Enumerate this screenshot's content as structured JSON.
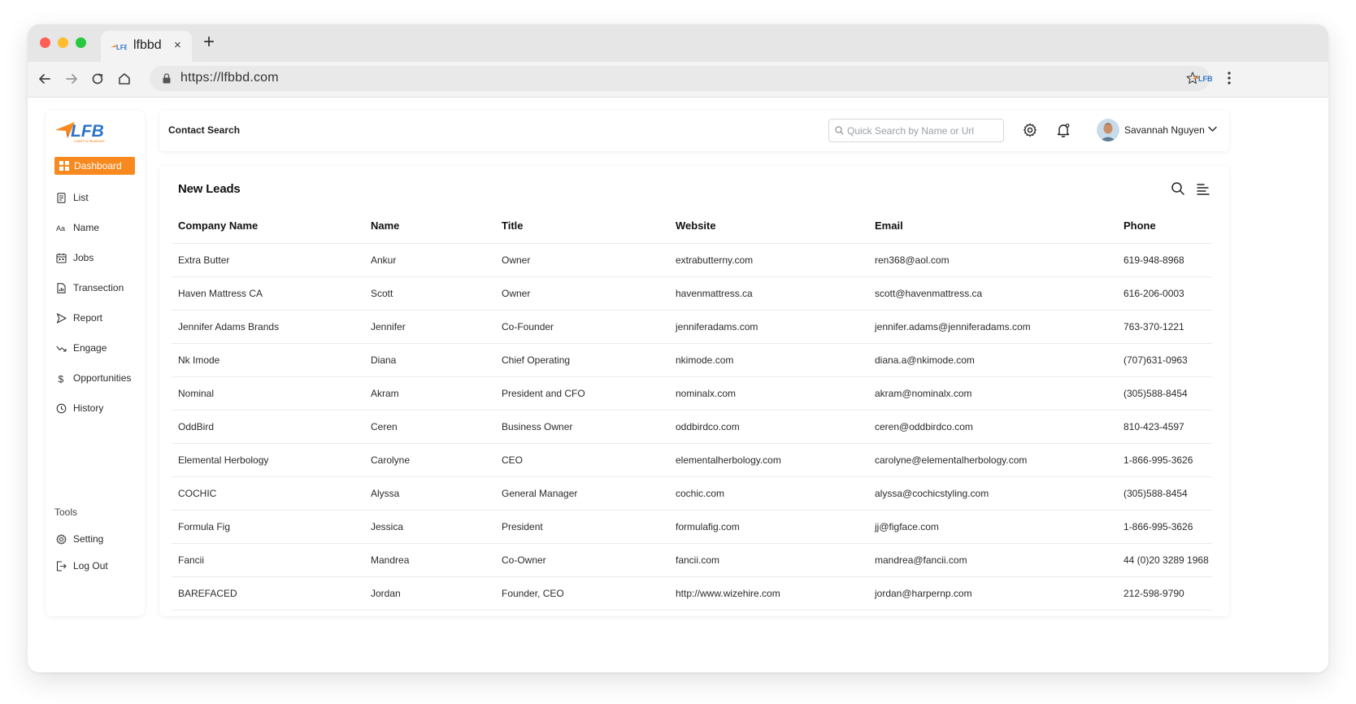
{
  "browser": {
    "tab_title": "lfbbd",
    "tab_close": "×",
    "new_tab": "+",
    "url": "https://lfbbd.com"
  },
  "brand": {
    "logo_text": "LFB",
    "logo_tagline": "Lead For Business",
    "accent_color": "#f7891f",
    "logo_blue": "#2b74c9"
  },
  "sidebar": {
    "dashboard_label": "Dashboard",
    "items": [
      {
        "label": "List",
        "icon": "list-doc-icon"
      },
      {
        "label": "Name",
        "icon": "text-aa-icon"
      },
      {
        "label": "Jobs",
        "icon": "calendar-icon"
      },
      {
        "label": "Transection",
        "icon": "file-chart-icon"
      },
      {
        "label": "Report",
        "icon": "send-arrow-icon"
      },
      {
        "label": "Engage",
        "icon": "trend-icon"
      },
      {
        "label": "Opportunities",
        "icon": "dollar-icon"
      },
      {
        "label": "History",
        "icon": "history-icon"
      }
    ],
    "tools_label": "Tools",
    "tools": [
      {
        "label": "Setting",
        "icon": "gear-icon"
      },
      {
        "label": "Log Out",
        "icon": "logout-icon"
      }
    ]
  },
  "topbar": {
    "title": "Contact Search",
    "search_placeholder": "Quick Search by Name or Url",
    "user_name": "Savannah Nguyen"
  },
  "leads": {
    "title": "New Leads",
    "columns": [
      "Company Name",
      "Name",
      "Title",
      "Website",
      "Email",
      "Phone"
    ],
    "rows": [
      [
        "Extra Butter",
        "Ankur",
        "Owner",
        "extrabutterny.com",
        "ren368@aol.com",
        "619-948-8968"
      ],
      [
        "Haven Mattress CA",
        "Scott",
        "Owner",
        "havenmattress.ca",
        "scott@havenmattress.ca",
        "616-206-0003"
      ],
      [
        "Jennifer Adams Brands",
        "Jennifer",
        "Co-Founder",
        "jenniferadams.com",
        "jennifer.adams@jenniferadams.com",
        "763-370-1221"
      ],
      [
        "Nk Imode",
        "Diana",
        "Chief Operating",
        "nkimode.com",
        "diana.a@nkimode.com",
        "(707)631-0963"
      ],
      [
        "Nominal",
        "Akram",
        "President and CFO",
        "nominalx.com",
        "akram@nominalx.com",
        "(305)588-8454"
      ],
      [
        "OddBird",
        "Ceren",
        "Business Owner",
        "oddbirdco.com",
        "ceren@oddbirdco.com",
        "810-423-4597"
      ],
      [
        "Elemental Herbology",
        "Carolyne",
        "CEO",
        "elementalherbology.com",
        "carolyne@elementalherbology.com",
        "1-866-995-3626"
      ],
      [
        "COCHIC",
        "Alyssa",
        "General Manager",
        "cochic.com",
        "alyssa@cochicstyling.com",
        "(305)588-8454"
      ],
      [
        "Formula Fig",
        "Jessica",
        "President",
        "formulafig.com",
        "jj@figface.com",
        "1-866-995-3626"
      ],
      [
        "Fancii",
        "Mandrea",
        "Co-Owner",
        "fancii.com",
        "mandrea@fancii.com",
        "44 (0)20 3289 1968"
      ],
      [
        "BAREFACED",
        "Jordan",
        "Founder, CEO",
        "http://www.wizehire.com",
        "jordan@harpernp.com",
        "212-598-9790"
      ]
    ]
  }
}
